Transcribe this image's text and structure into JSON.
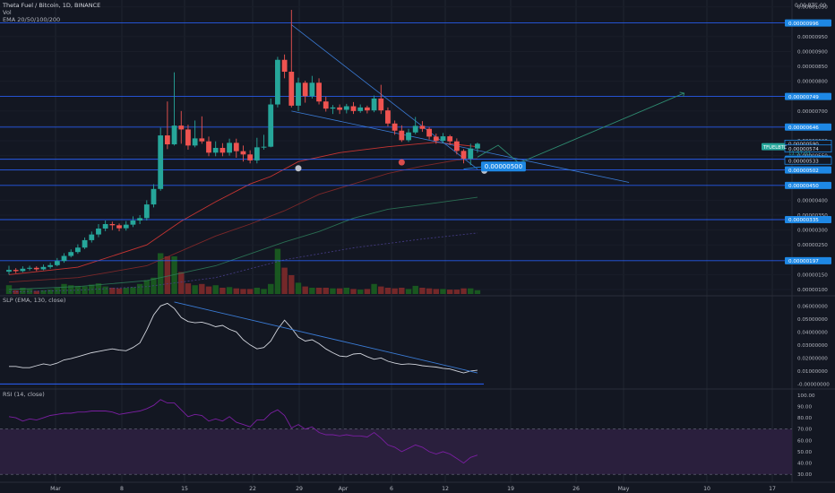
{
  "header": {
    "title": "Theta Fuel / Bitcoin, 1D, BINANCE",
    "vol_label": "Vol",
    "ema_label": "EMA 20/50/100/200"
  },
  "slp_label": "SLP (EMA, 130, close)",
  "rsi_label": "RSI (14, close)",
  "colors": {
    "background": "#131722",
    "up": "#26a69a",
    "down": "#ef5350",
    "hline": "#2962ff",
    "label_bg": "#1e88e5",
    "ema20": "#e53935",
    "ema50": "#8d2a2a",
    "ema100": "#2e7d5b",
    "ema200": "#4a3f8f",
    "projection": "#2e8b70",
    "rsi_band": "#2a1f3d",
    "rsi_line": "#7b1fa2",
    "slp_line": "#d1d4dc"
  },
  "chart_data": [
    {
      "type": "candlestick",
      "title": "Theta Fuel / Bitcoin, 1D, BINANCE",
      "ylim": [
        8.5e-07,
        1.055e-05
      ],
      "x_ticks": [
        "Mar",
        "8",
        "15",
        "22",
        "29",
        "Apr",
        "6",
        "12",
        "19",
        "26",
        "May",
        "10",
        "17"
      ],
      "y_ticks": [
        "0.00001050",
        "0.00000950",
        "0.00000900",
        "0.00000850",
        "0.00000800",
        "0.00000700",
        "0.00000650",
        "0.00000600",
        "0.00000550",
        "0.00000500",
        "0.00000400",
        "0.00000350",
        "0.00000300",
        "0.00000250",
        "0.00000150",
        "0.00000100"
      ],
      "top_axis_label": "0.00 BTC 00",
      "horizontal_levels": [
        {
          "value": 9.96e-06,
          "label": "0.00000996"
        },
        {
          "value": 7.49e-06,
          "label": "0.00000749"
        },
        {
          "value": 6.46e-06,
          "label": "0.00000646"
        },
        {
          "value": 5.38e-06,
          "label": "0.00000538"
        },
        {
          "value": 5.02e-06,
          "label": "0.00000502"
        },
        {
          "value": 4.5e-06,
          "label": "0.00000450"
        },
        {
          "value": 3.35e-06,
          "label": "0.00000335"
        },
        {
          "value": 1.97e-06,
          "label": "0.00000197"
        }
      ],
      "price_tags": [
        {
          "value": 5.9e-06,
          "label": "0.00000590",
          "style": "outline"
        },
        {
          "value": 5.74e-06,
          "label": "0.00000574",
          "style": "outline"
        },
        {
          "value": 5.6e-06,
          "label": "11:57:01",
          "style": "plain"
        },
        {
          "value": 5.33e-06,
          "label": "0.00000533",
          "style": "outline"
        }
      ],
      "symbol_tag": "TFUELBTC",
      "annotation": "0.00000500",
      "candles": [
        [
          1.6e-06,
          1.66e-06,
          1.8e-06,
          1.5e-06
        ],
        [
          1.66e-06,
          1.62e-06,
          1.72e-06,
          1.55e-06
        ],
        [
          1.62e-06,
          1.7e-06,
          1.78e-06,
          1.58e-06
        ],
        [
          1.7e-06,
          1.73e-06,
          1.8e-06,
          1.64e-06
        ],
        [
          1.73e-06,
          1.68e-06,
          1.78e-06,
          1.62e-06
        ],
        [
          1.68e-06,
          1.76e-06,
          1.84e-06,
          1.65e-06
        ],
        [
          1.76e-06,
          1.82e-06,
          1.9e-06,
          1.7e-06
        ],
        [
          1.82e-06,
          1.96e-06,
          2.06e-06,
          1.78e-06
        ],
        [
          1.96e-06,
          2.13e-06,
          2.22e-06,
          1.9e-06
        ],
        [
          2.13e-06,
          2.26e-06,
          2.35e-06,
          2.08e-06
        ],
        [
          2.26e-06,
          2.41e-06,
          2.52e-06,
          2.2e-06
        ],
        [
          2.41e-06,
          2.66e-06,
          2.75e-06,
          2.36e-06
        ],
        [
          2.66e-06,
          2.85e-06,
          2.95e-06,
          2.58e-06
        ],
        [
          2.85e-06,
          3.05e-06,
          3.2e-06,
          2.76e-06
        ],
        [
          3.05e-06,
          3.2e-06,
          3.32e-06,
          2.96e-06
        ],
        [
          3.2e-06,
          3.16e-06,
          3.28e-06,
          3e-06
        ],
        [
          3.16e-06,
          3.06e-06,
          3.22e-06,
          2.96e-06
        ],
        [
          3.06e-06,
          3.18e-06,
          3.3e-06,
          2.98e-06
        ],
        [
          3.18e-06,
          3.32e-06,
          3.46e-06,
          3.1e-06
        ],
        [
          3.32e-06,
          3.4e-06,
          3.5e-06,
          3.2e-06
        ],
        [
          3.4e-06,
          3.86e-06,
          4e-06,
          3.32e-06
        ],
        [
          3.86e-06,
          4.38e-06,
          4.54e-06,
          3.76e-06
        ],
        [
          4.38e-06,
          6.18e-06,
          6.44e-06,
          4.32e-06
        ],
        [
          6.18e-06,
          5.88e-06,
          7.32e-06,
          5.72e-06
        ],
        [
          5.88e-06,
          6.51e-06,
          8.3e-06,
          5.84e-06
        ],
        [
          6.51e-06,
          6.38e-06,
          7e-06,
          5.9e-06
        ],
        [
          6.38e-06,
          5.84e-06,
          6.54e-06,
          5.7e-06
        ],
        [
          5.84e-06,
          6.08e-06,
          6.68e-06,
          5.78e-06
        ],
        [
          6.08e-06,
          5.98e-06,
          6.82e-06,
          5.9e-06
        ],
        [
          5.98e-06,
          5.6e-06,
          6.14e-06,
          5.48e-06
        ],
        [
          5.6e-06,
          5.76e-06,
          5.98e-06,
          5.48e-06
        ],
        [
          5.76e-06,
          5.6e-06,
          5.92e-06,
          5.48e-06
        ],
        [
          5.6e-06,
          5.93e-06,
          6.07e-06,
          5.5e-06
        ],
        [
          5.93e-06,
          5.65e-06,
          6.07e-06,
          5.43e-06
        ],
        [
          5.65e-06,
          5.54e-06,
          5.84e-06,
          5.3e-06
        ],
        [
          5.54e-06,
          5.34e-06,
          5.68e-06,
          5.24e-06
        ],
        [
          5.34e-06,
          5.78e-06,
          6.1e-06,
          5.24e-06
        ],
        [
          5.78e-06,
          5.8e-06,
          6.2e-06,
          5.7e-06
        ],
        [
          5.8e-06,
          7.22e-06,
          7.42e-06,
          5.78e-06
        ],
        [
          7.22e-06,
          8.72e-06,
          8.82e-06,
          7.12e-06
        ],
        [
          8.72e-06,
          8.32e-06,
          8.9e-06,
          8.1e-06
        ],
        [
          8.32e-06,
          7.18e-06,
          1.04e-05,
          7.12e-06
        ],
        [
          7.18e-06,
          7.95e-06,
          8.12e-06,
          7e-06
        ],
        [
          7.95e-06,
          7.5e-06,
          8.02e-06,
          7.28e-06
        ],
        [
          7.5e-06,
          7.95e-06,
          8.18e-06,
          7.42e-06
        ],
        [
          7.95e-06,
          7.32e-06,
          8.1e-06,
          7.22e-06
        ],
        [
          7.32e-06,
          7.08e-06,
          7.48e-06,
          6.98e-06
        ],
        [
          7.08e-06,
          7.12e-06,
          7.2e-06,
          6.9e-06
        ],
        [
          7.12e-06,
          7.04e-06,
          7.22e-06,
          6.9e-06
        ],
        [
          7.04e-06,
          7.16e-06,
          7.24e-06,
          6.92e-06
        ],
        [
          7.16e-06,
          7e-06,
          7.3e-06,
          6.9e-06
        ],
        [
          7e-06,
          7.12e-06,
          7.22e-06,
          6.94e-06
        ],
        [
          7.12e-06,
          7.02e-06,
          7.18e-06,
          6.92e-06
        ],
        [
          7.02e-06,
          7.42e-06,
          7.52e-06,
          6.96e-06
        ],
        [
          7.42e-06,
          7.02e-06,
          7.88e-06,
          6.9e-06
        ],
        [
          7.02e-06,
          6.58e-06,
          7.12e-06,
          6.48e-06
        ],
        [
          6.58e-06,
          6.34e-06,
          6.68e-06,
          6.2e-06
        ],
        [
          6.34e-06,
          6.02e-06,
          6.52e-06,
          5.96e-06
        ],
        [
          6.02e-06,
          6.28e-06,
          6.4e-06,
          5.96e-06
        ],
        [
          6.28e-06,
          6.5e-06,
          6.8e-06,
          6.22e-06
        ],
        [
          6.5e-06,
          6.4e-06,
          6.66e-06,
          6.3e-06
        ],
        [
          6.4e-06,
          6.14e-06,
          6.46e-06,
          6.04e-06
        ],
        [
          6.14e-06,
          6e-06,
          6.24e-06,
          5.9e-06
        ],
        [
          6e-06,
          6.15e-06,
          6.26e-06,
          5.92e-06
        ],
        [
          6.15e-06,
          5.98e-06,
          6.2e-06,
          5.86e-06
        ],
        [
          5.98e-06,
          5.66e-06,
          6.08e-06,
          5.54e-06
        ],
        [
          5.66e-06,
          5.4e-06,
          5.72e-06,
          5.24e-06
        ],
        [
          5.4e-06,
          5.74e-06,
          5.9e-06,
          5.18e-06
        ],
        [
          5.74e-06,
          5.9e-06,
          5.94e-06,
          5.6e-06
        ]
      ],
      "volume": [
        0.14,
        0.06,
        0.1,
        0.08,
        0.05,
        0.06,
        0.07,
        0.1,
        0.16,
        0.14,
        0.13,
        0.12,
        0.15,
        0.17,
        0.12,
        0.1,
        0.09,
        0.1,
        0.11,
        0.16,
        0.22,
        0.26,
        0.65,
        0.6,
        0.6,
        0.35,
        0.17,
        0.14,
        0.16,
        0.12,
        0.14,
        0.1,
        0.11,
        0.09,
        0.08,
        0.08,
        0.1,
        0.08,
        0.16,
        0.72,
        0.42,
        0.3,
        0.18,
        0.12,
        0.1,
        0.1,
        0.1,
        0.09,
        0.09,
        0.1,
        0.08,
        0.07,
        0.08,
        0.16,
        0.12,
        0.1,
        0.09,
        0.1,
        0.08,
        0.13,
        0.1,
        0.09,
        0.08,
        0.08,
        0.07,
        0.07,
        0.09,
        0.09,
        0.06
      ],
      "ema": [
        {
          "name": "EMA 20",
          "points": [
            [
              0,
              1.5e-06
            ],
            [
              10,
              1.75e-06
            ],
            [
              20,
              2.5e-06
            ],
            [
              25,
              3.3e-06
            ],
            [
              30,
              3.95e-06
            ],
            [
              35,
              4.55e-06
            ],
            [
              38,
              4.8e-06
            ],
            [
              42,
              5.3e-06
            ],
            [
              48,
              5.6e-06
            ],
            [
              55,
              5.8e-06
            ],
            [
              62,
              5.95e-06
            ],
            [
              68,
              5.8e-06
            ]
          ]
        },
        {
          "name": "EMA 50",
          "points": [
            [
              0,
              1.25e-06
            ],
            [
              10,
              1.4e-06
            ],
            [
              20,
              1.8e-06
            ],
            [
              25,
              2.3e-06
            ],
            [
              30,
              2.8e-06
            ],
            [
              35,
              3.2e-06
            ],
            [
              40,
              3.65e-06
            ],
            [
              45,
              4.2e-06
            ],
            [
              50,
              4.55e-06
            ],
            [
              55,
              4.9e-06
            ],
            [
              60,
              5.15e-06
            ],
            [
              65,
              5.35e-06
            ],
            [
              68,
              5.4e-06
            ]
          ]
        },
        {
          "name": "EMA 100",
          "points": [
            [
              0,
              1e-06
            ],
            [
              10,
              1.1e-06
            ],
            [
              20,
              1.3e-06
            ],
            [
              30,
              1.8e-06
            ],
            [
              35,
              2.2e-06
            ],
            [
              40,
              2.6e-06
            ],
            [
              45,
              2.95e-06
            ],
            [
              50,
              3.4e-06
            ],
            [
              55,
              3.7e-06
            ],
            [
              60,
              3.85e-06
            ],
            [
              68,
              4.1e-06
            ]
          ]
        },
        {
          "name": "EMA 200",
          "points": [
            [
              0,
              9.2e-07
            ],
            [
              10,
              9.8e-07
            ],
            [
              20,
              1.1e-06
            ],
            [
              30,
              1.4e-06
            ],
            [
              35,
              1.7e-06
            ],
            [
              40,
              2e-06
            ],
            [
              45,
              2.2e-06
            ],
            [
              50,
              2.4e-06
            ],
            [
              55,
              2.55e-06
            ],
            [
              60,
              2.7e-06
            ],
            [
              68,
              2.9e-06
            ]
          ]
        }
      ],
      "trendlines": [
        {
          "from": [
            41,
            9.9e-06
          ],
          "to": [
            68,
            5.05e-06
          ]
        },
        {
          "from": [
            41,
            7e-06
          ],
          "to": [
            90,
            4.6e-06
          ]
        }
      ],
      "projection": [
        [
          68,
          5.45e-06
        ],
        [
          71,
          5.85e-06
        ],
        [
          74,
          5.25e-06
        ],
        [
          98,
          7.6e-06
        ]
      ],
      "events_markers": [
        [
          42,
          6.28e-06
        ],
        [
          57,
          6.48e-06
        ],
        [
          69,
          6.2e-06
        ]
      ]
    },
    {
      "type": "line",
      "title": "SLP (EMA, 130, close)",
      "ylim": [
        -0.0025,
        0.065
      ],
      "y_ticks": [
        "0.06000000",
        "0.05000000",
        "0.04000000",
        "0.03000000",
        "0.02000000",
        "0.01000000",
        "-0.00000000"
      ],
      "values": [
        0.0135,
        0.0135,
        0.0125,
        0.0125,
        0.014,
        0.0155,
        0.0145,
        0.016,
        0.0185,
        0.0195,
        0.021,
        0.0225,
        0.024,
        0.025,
        0.026,
        0.027,
        0.026,
        0.0255,
        0.028,
        0.0315,
        0.0415,
        0.053,
        0.06,
        0.062,
        0.058,
        0.051,
        0.048,
        0.047,
        0.0475,
        0.046,
        0.044,
        0.045,
        0.042,
        0.04,
        0.034,
        0.03,
        0.027,
        0.028,
        0.033,
        0.042,
        0.049,
        0.043,
        0.036,
        0.033,
        0.034,
        0.031,
        0.027,
        0.024,
        0.0215,
        0.021,
        0.023,
        0.0235,
        0.021,
        0.019,
        0.02,
        0.0175,
        0.016,
        0.015,
        0.0155,
        0.015,
        0.014,
        0.0135,
        0.013,
        0.012,
        0.0115,
        0.01,
        0.0085,
        0.01,
        0.0105
      ],
      "trendline": {
        "from": [
          24,
          0.063
        ],
        "to": [
          68,
          0.0085
        ]
      },
      "zero_line": 0.0
    },
    {
      "type": "line",
      "title": "RSI (14, close)",
      "ylim": [
        27,
        103
      ],
      "y_ticks": [
        "100.00",
        "90.00",
        "80.00",
        "70.00",
        "60.00",
        "50.00",
        "40.00",
        "30.00"
      ],
      "band": [
        30,
        70
      ],
      "values": [
        81,
        80,
        77,
        79,
        78,
        80,
        82,
        83,
        84,
        84,
        85,
        85,
        86,
        86,
        86,
        85,
        83,
        84,
        85,
        86,
        88,
        91,
        96,
        93,
        93,
        87,
        81,
        83,
        82,
        77,
        79,
        77,
        81,
        76,
        74,
        72,
        78,
        78,
        84,
        87,
        82,
        71,
        74,
        70,
        72,
        67,
        65,
        65,
        64,
        65,
        64,
        64,
        63,
        67,
        62,
        56,
        54,
        50,
        53,
        56,
        54,
        50,
        48,
        50,
        48,
        44,
        40,
        45,
        47
      ]
    }
  ]
}
